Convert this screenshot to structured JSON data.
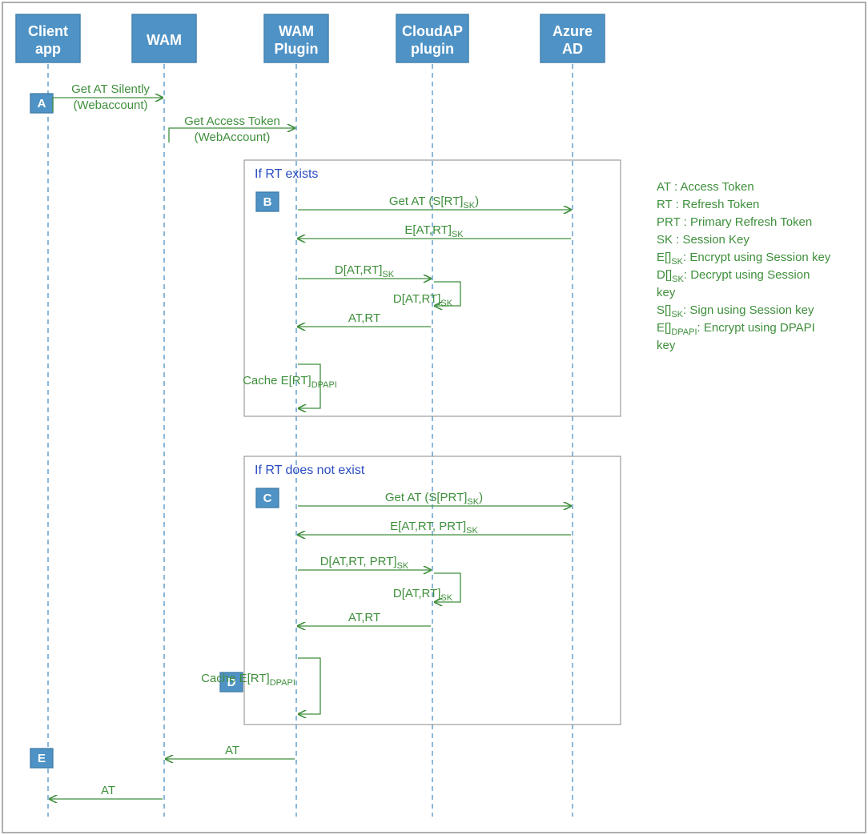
{
  "participants": {
    "client": {
      "l1": "Client",
      "l2": "app"
    },
    "wam": {
      "l1": "WAM"
    },
    "plugin": {
      "l1": "WAM",
      "l2": "Plugin"
    },
    "cloudap": {
      "l1": "CloudAP",
      "l2": "plugin"
    },
    "aad": {
      "l1": "Azure",
      "l2": "AD"
    }
  },
  "steps": {
    "A": "A",
    "B": "B",
    "C": "C",
    "D": "D",
    "E": "E"
  },
  "boxtitles": {
    "rt_exists": "If RT exists",
    "rt_not": "If RT does not exist"
  },
  "messages": {
    "m1_l1": "Get AT Silently",
    "m1_l2": "(Webaccount)",
    "m2_l1": "Get Access Token",
    "m2_l2": "(WebAccount)",
    "b_getat": "Get AT  (S[RT]",
    "b_getat_close": ")",
    "b_enc": "E[AT,RT]",
    "b_dec1": "D[AT,RT]",
    "b_dec2": "D[AT,RT]",
    "b_atrt": "AT,RT",
    "b_cache": "Cache E[RT]",
    "c_getat": "Get AT  (S[PRT]",
    "c_getat_close": ")",
    "c_enc": "E[AT,RT, PRT]",
    "c_dec1": "D[AT,RT, PRT]",
    "c_dec2": "D[AT,RT]",
    "c_atrt": "AT,RT",
    "c_cache": "Cache E[RT]",
    "ret1": "AT",
    "ret2": "AT"
  },
  "sub": {
    "sk": "SK",
    "dpapi": "DPAPI"
  },
  "legend": [
    "AT : Access Token",
    "RT : Refresh Token",
    "PRT : Primary Refresh Token",
    "SK : Session Key",
    "E[]SK : Encrypt using Session key",
    "D[]SK : Decrypt using Session key",
    "S[]SK : Sign using Session key",
    "E[]DPAPI : Encrypt using DPAPI key"
  ],
  "legend_subs": {
    "4": {
      "start": "E[]",
      "sub": "SK",
      "rest": ": Encrypt using Session key"
    },
    "5": {
      "start": "D[]",
      "sub": "SK",
      "rest": ": Decrypt using Session key"
    },
    "6": {
      "start": "S[]",
      "sub": "SK",
      "rest": ": Sign using Session key"
    },
    "7": {
      "start": "E[]",
      "sub": "DPAPI",
      "rest": ": Encrypt using DPAPI key"
    }
  }
}
